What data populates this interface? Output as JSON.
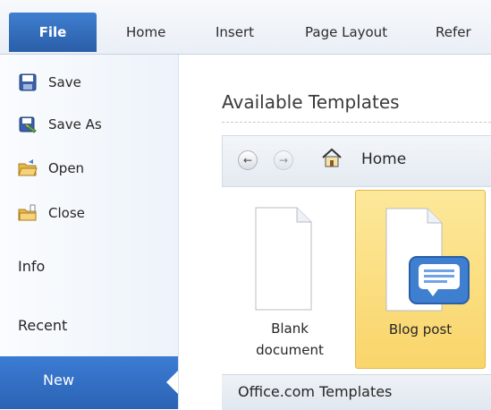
{
  "ribbon": {
    "tabs": [
      {
        "label": "File"
      },
      {
        "label": "Home"
      },
      {
        "label": "Insert"
      },
      {
        "label": "Page Layout"
      },
      {
        "label": "Refer"
      }
    ]
  },
  "backstage_nav": {
    "commands": [
      {
        "label": "Save",
        "icon": "save-icon"
      },
      {
        "label": "Save As",
        "icon": "save-as-icon"
      },
      {
        "label": "Open",
        "icon": "open-folder-icon"
      },
      {
        "label": "Close",
        "icon": "close-folder-icon"
      }
    ],
    "sections": [
      {
        "label": "Info"
      },
      {
        "label": "Recent"
      },
      {
        "label": "New",
        "selected": true
      }
    ]
  },
  "main": {
    "title": "Available Templates",
    "nav": {
      "home_label": "Home"
    },
    "templates": [
      {
        "label_line1": "Blank",
        "label_line2": "document",
        "selected": false
      },
      {
        "label_line1": "Blog post",
        "label_line2": "",
        "selected": true
      }
    ],
    "office_section": "Office.com Templates"
  },
  "colors": {
    "file_tab": "#2a5ea8",
    "selected_nav": "#2b63b4",
    "selected_tile": "#f9d56a"
  }
}
